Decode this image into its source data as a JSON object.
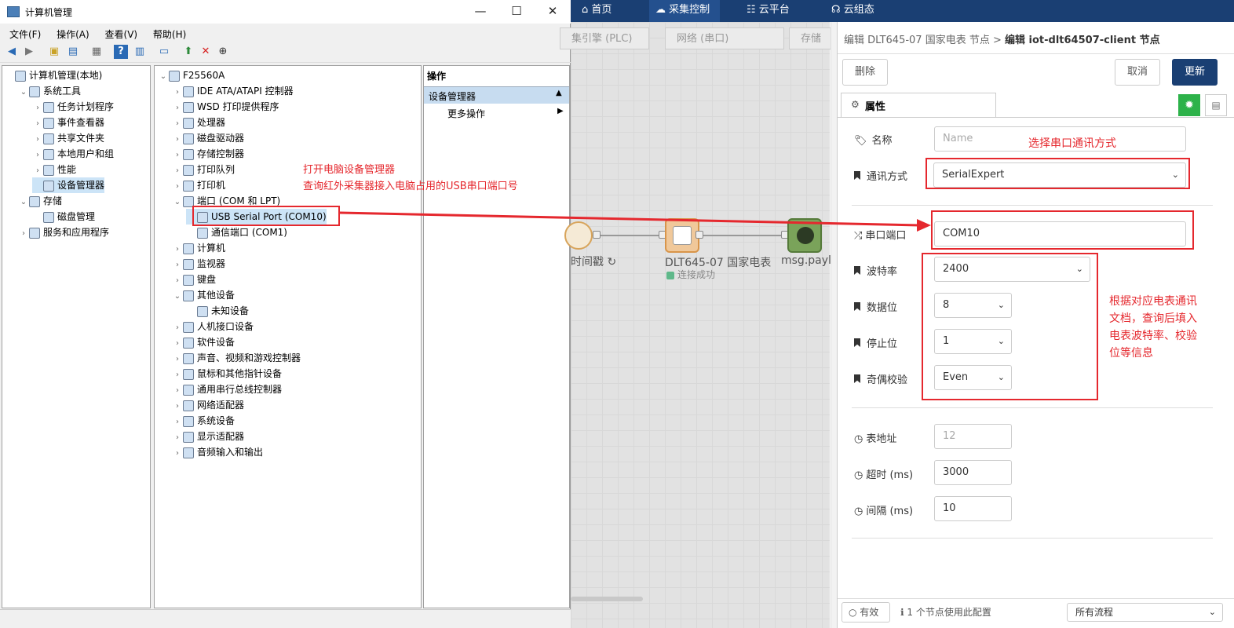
{
  "left_window": {
    "title": "计算机管理",
    "menu": [
      "文件(F)",
      "操作(A)",
      "查看(V)",
      "帮助(H)"
    ],
    "nav_tree": [
      {
        "label": "计算机管理(本地)",
        "level": 0,
        "expander": ""
      },
      {
        "label": "系统工具",
        "level": 1,
        "expander": "⌄"
      },
      {
        "label": "任务计划程序",
        "level": 2,
        "expander": "›"
      },
      {
        "label": "事件查看器",
        "level": 2,
        "expander": "›"
      },
      {
        "label": "共享文件夹",
        "level": 2,
        "expander": "›"
      },
      {
        "label": "本地用户和组",
        "level": 2,
        "expander": "›"
      },
      {
        "label": "性能",
        "level": 2,
        "expander": "›"
      },
      {
        "label": "设备管理器",
        "level": 2,
        "expander": ""
      },
      {
        "label": "存储",
        "level": 1,
        "expander": "⌄"
      },
      {
        "label": "磁盘管理",
        "level": 2,
        "expander": ""
      },
      {
        "label": "服务和应用程序",
        "level": 1,
        "expander": "›"
      }
    ],
    "device_tree": [
      {
        "label": "F25560A",
        "level": 0,
        "expander": "⌄"
      },
      {
        "label": "IDE ATA/ATAPI 控制器",
        "level": 1,
        "expander": "›"
      },
      {
        "label": "WSD 打印提供程序",
        "level": 1,
        "expander": "›"
      },
      {
        "label": "处理器",
        "level": 1,
        "expander": "›"
      },
      {
        "label": "磁盘驱动器",
        "level": 1,
        "expander": "›"
      },
      {
        "label": "存储控制器",
        "level": 1,
        "expander": "›"
      },
      {
        "label": "打印队列",
        "level": 1,
        "expander": "›"
      },
      {
        "label": "打印机",
        "level": 1,
        "expander": "›"
      },
      {
        "label": "端口 (COM 和 LPT)",
        "level": 1,
        "expander": "⌄"
      },
      {
        "label": "USB Serial Port (COM10)",
        "level": 2,
        "expander": ""
      },
      {
        "label": "通信端口 (COM1)",
        "level": 2,
        "expander": ""
      },
      {
        "label": "计算机",
        "level": 1,
        "expander": "›"
      },
      {
        "label": "监视器",
        "level": 1,
        "expander": "›"
      },
      {
        "label": "键盘",
        "level": 1,
        "expander": "›"
      },
      {
        "label": "其他设备",
        "level": 1,
        "expander": "⌄"
      },
      {
        "label": "未知设备",
        "level": 2,
        "expander": ""
      },
      {
        "label": "人机接口设备",
        "level": 1,
        "expander": "›"
      },
      {
        "label": "软件设备",
        "level": 1,
        "expander": "›"
      },
      {
        "label": "声音、视频和游戏控制器",
        "level": 1,
        "expander": "›"
      },
      {
        "label": "鼠标和其他指针设备",
        "level": 1,
        "expander": "›"
      },
      {
        "label": "通用串行总线控制器",
        "level": 1,
        "expander": "›"
      },
      {
        "label": "网络适配器",
        "level": 1,
        "expander": "›"
      },
      {
        "label": "系统设备",
        "level": 1,
        "expander": "›"
      },
      {
        "label": "显示适配器",
        "level": 1,
        "expander": "›"
      },
      {
        "label": "音频输入和输出",
        "level": 1,
        "expander": "›"
      }
    ],
    "actions": {
      "header": "操作",
      "section": "设备管理器",
      "more": "更多操作"
    },
    "annotation_line1": "打开电脑设备管理器",
    "annotation_line2": "查询红外采集器接入电脑占用的USB串口端口号"
  },
  "right_app": {
    "nav": {
      "home": "首页",
      "collect": "采集控制",
      "cloud": "云平台",
      "cloud_config": "云组态"
    },
    "flow_tabs": [
      "集引擎 (PLC)",
      "网络 (串口)",
      "存储"
    ],
    "nodes": {
      "left_label": "时间戳 ↻",
      "middle_label": "DLT645-07 国家电表",
      "middle_status": "连接成功",
      "right_label": "msg.paylo"
    },
    "breadcrumb_prefix": "编辑 DLT645-07 国家电表 节点 > ",
    "breadcrumb_current": "编辑 iot-dlt64507-client 节点",
    "buttons": {
      "delete": "删除",
      "cancel": "取消",
      "update": "更新"
    },
    "props_tab": "属性",
    "fields": {
      "name_label": "名称",
      "name_placeholder": "Name",
      "comm_label": "通讯方式",
      "comm_value": "SerialExpert",
      "port_label": "串口端口",
      "port_value": "COM10",
      "baud_label": "波特率",
      "baud_value": "2400",
      "databits_label": "数据位",
      "databits_value": "8",
      "stopbits_label": "停止位",
      "stopbits_value": "1",
      "parity_label": "奇偶校验",
      "parity_value": "Even",
      "addr_label": "表地址",
      "addr_placeholder": "12",
      "timeout_label": "超时 (ms)",
      "timeout_value": "3000",
      "interval_label": "间隔 (ms)",
      "interval_value": "10"
    },
    "annotation_comm": "选择串口通讯方式",
    "annotation_serial": "根据对应电表通讯文档，查询后填入电表波特率、校验位等信息",
    "footer": {
      "enabled": "有效",
      "usage": "1 个节点使用此配置",
      "scope": "所有流程"
    },
    "colors": {
      "nav": "#1a3f73",
      "primary": "#1a3f73",
      "annotation": "#e5282e",
      "green": "#2db24a"
    }
  }
}
